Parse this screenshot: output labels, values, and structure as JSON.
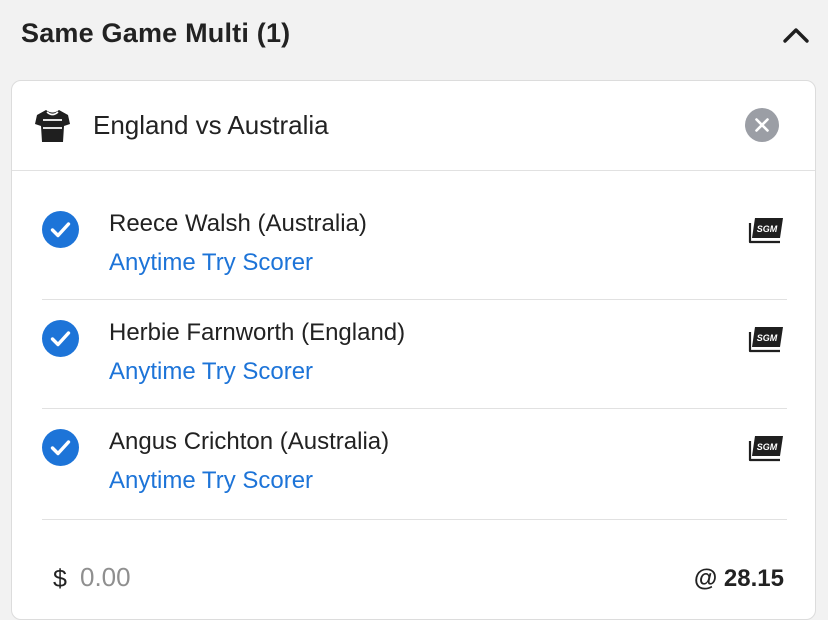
{
  "header": {
    "title": "Same Game Multi (1)",
    "collapse_icon": "chevron-up-icon"
  },
  "event": {
    "icon": "jersey-icon",
    "title": "England vs Australia",
    "remove_icon": "close-icon"
  },
  "legs": [
    {
      "selection": "Reece Walsh (Australia)",
      "market": "Anytime Try Scorer",
      "badge": "SGM",
      "checked": true
    },
    {
      "selection": "Herbie Farnworth (England)",
      "market": "Anytime Try Scorer",
      "badge": "SGM",
      "checked": true
    },
    {
      "selection": "Angus Crichton (Australia)",
      "market": "Anytime Try Scorer",
      "badge": "SGM",
      "checked": true
    }
  ],
  "stake": {
    "currency": "$",
    "placeholder": "0.00",
    "value": ""
  },
  "odds": "@ 28.15",
  "colors": {
    "accent_blue": "#1d74d8",
    "header_bg": "#f2f2f2",
    "close_bg": "#9b9ea5"
  }
}
